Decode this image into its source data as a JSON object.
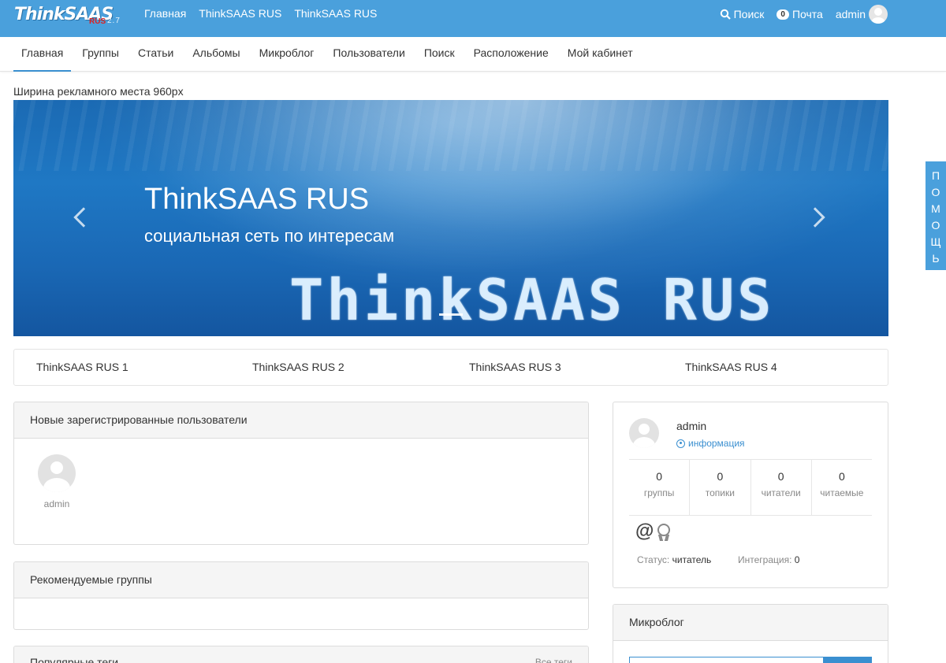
{
  "header": {
    "logo_text": "ThinkSAAS",
    "logo_badge": "RUS",
    "logo_version": "2.7",
    "nav": [
      "Главная",
      "ThinkSAAS RUS",
      "ThinkSAAS RUS"
    ],
    "search_label": "Поиск",
    "mail_count": "0",
    "mail_label": "Почта",
    "user_label": "admin"
  },
  "subnav": {
    "items": [
      "Главная",
      "Группы",
      "Статьи",
      "Альбомы",
      "Микроблог",
      "Пользователи",
      "Поиск",
      "Расположение",
      "Мой кабинет"
    ],
    "active_index": 0
  },
  "ad_label": "Ширина рекламного места 960px",
  "banner": {
    "title": "ThinkSAAS RUS",
    "subtitle": "социальная сеть по интересам",
    "watermark": "ThinkSAAS RUS"
  },
  "links": [
    "ThinkSAAS RUS 1",
    "ThinkSAAS RUS 2",
    "ThinkSAAS RUS 3",
    "ThinkSAAS RUS 4"
  ],
  "new_users": {
    "title": "Новые зарегистрированные пользователи",
    "users": [
      "admin"
    ]
  },
  "recommended_groups": {
    "title": "Рекомендуемые группы"
  },
  "popular_tags": {
    "title": "Популярные теги",
    "all_label": "Все теги"
  },
  "profile": {
    "name": "admin",
    "info_label": "информация",
    "stats": [
      {
        "value": "0",
        "label": "группы"
      },
      {
        "value": "0",
        "label": "топики"
      },
      {
        "value": "0",
        "label": "читатели"
      },
      {
        "value": "0",
        "label": "читаемые"
      }
    ],
    "status_label": "Статус:",
    "status_value": "читатель",
    "integration_label": "Интеграция:",
    "integration_value": "0"
  },
  "microblog": {
    "title": "Микроблог"
  },
  "help_label": [
    "П",
    "О",
    "М",
    "О",
    "Щ",
    "Ь"
  ],
  "colors": {
    "topbar": "#4aa0dc",
    "accent": "#3a8fd0"
  }
}
